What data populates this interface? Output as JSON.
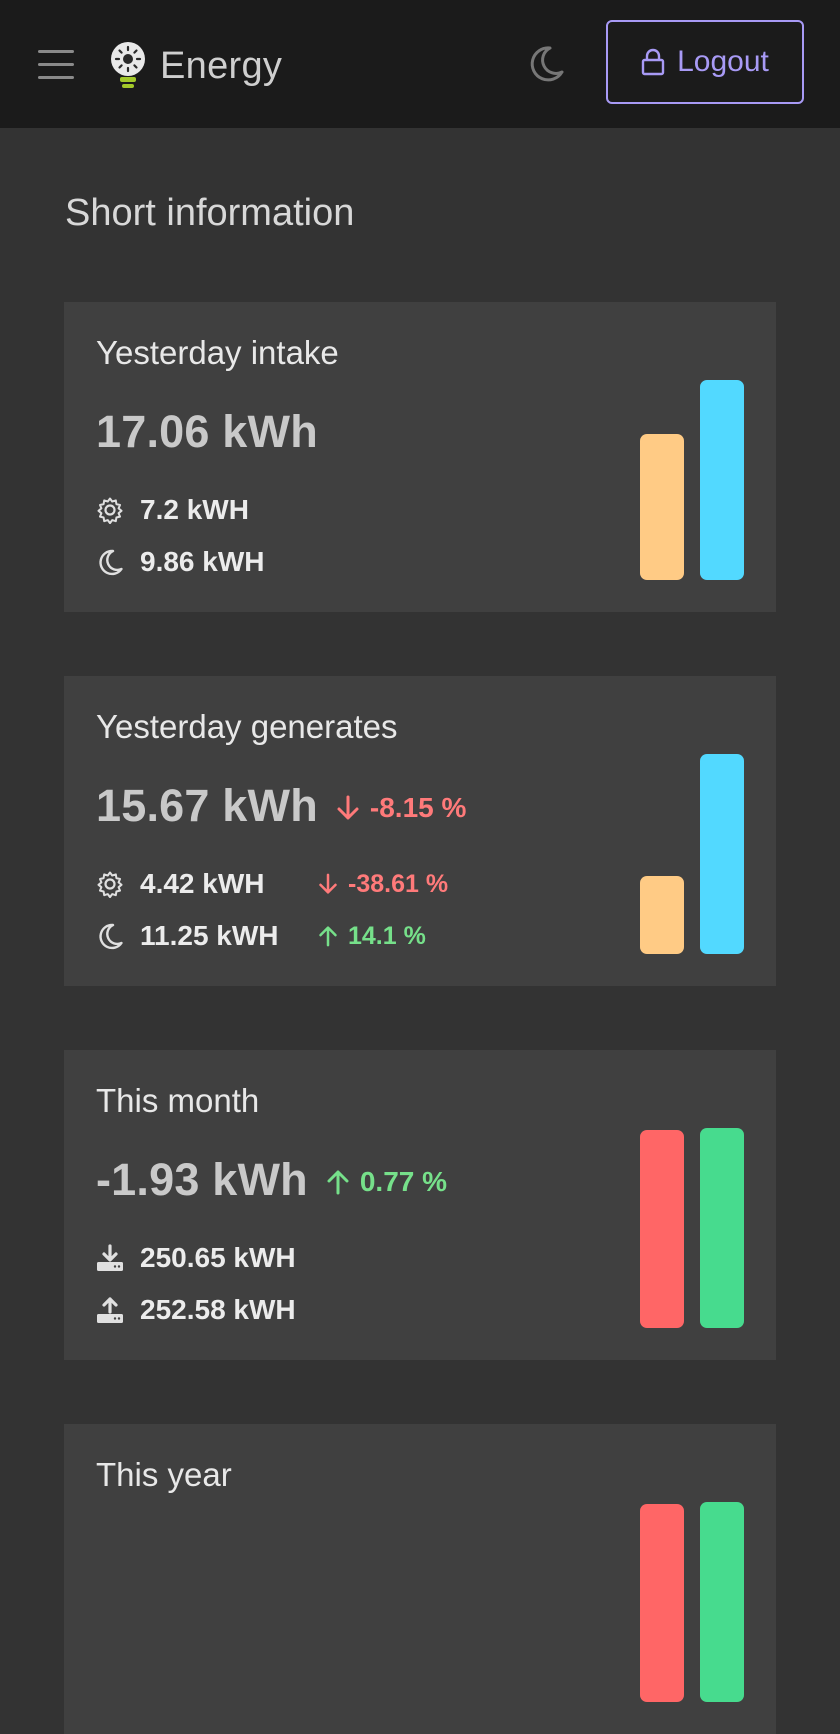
{
  "header": {
    "brand": "Energy",
    "logout_label": "Logout",
    "icons": {
      "menu": "hamburger-icon",
      "brand": "lightbulb-sun-icon",
      "theme": "moon-icon",
      "logout": "lock-icon"
    }
  },
  "section": {
    "title": "Short information"
  },
  "colors": {
    "navbar_bg": "#1b1b1b",
    "page_bg": "#333333",
    "card_bg": "#404040",
    "accent": "#a89af5",
    "bar_day": "#ffcb85",
    "bar_night": "#52d9ff",
    "bar_intake": "#ff6666",
    "bar_output": "#47db8e",
    "decrease": "#ff7a7a",
    "increase": "#76e08a"
  },
  "cards": [
    {
      "title": "Yesterday intake",
      "total": "17.06 kWh",
      "change": null,
      "rows": [
        {
          "icon": "gear-icon",
          "value": "7.2 kWH",
          "change": null
        },
        {
          "icon": "moon-icon",
          "value": "9.86 kWH",
          "change": null
        }
      ],
      "bars": [
        {
          "name": "day",
          "color": "#ffcb85",
          "level": 0.73
        },
        {
          "name": "night",
          "color": "#52d9ff",
          "level": 1.0
        }
      ]
    },
    {
      "title": "Yesterday generates",
      "total": "15.67 kWh",
      "change": {
        "direction": "down",
        "text": "-8.15 %"
      },
      "rows": [
        {
          "icon": "gear-icon",
          "value": "4.42 kWH",
          "change": {
            "direction": "down",
            "text": "-38.61 %"
          }
        },
        {
          "icon": "moon-icon",
          "value": "11.25 kWH",
          "change": {
            "direction": "up",
            "text": "14.1 %"
          }
        }
      ],
      "bars": [
        {
          "name": "day",
          "color": "#ffcb85",
          "level": 0.39
        },
        {
          "name": "night",
          "color": "#52d9ff",
          "level": 1.0
        }
      ]
    },
    {
      "title": "This month",
      "total": "-1.93 kWh",
      "change": {
        "direction": "up",
        "text": "0.77 %"
      },
      "rows": [
        {
          "icon": "download-icon",
          "value": "250.65 kWH",
          "change": null
        },
        {
          "icon": "upload-icon",
          "value": "252.58 kWH",
          "change": null
        }
      ],
      "bars": [
        {
          "name": "intake",
          "color": "#ff6666",
          "level": 0.99
        },
        {
          "name": "output",
          "color": "#47db8e",
          "level": 1.0
        }
      ]
    },
    {
      "title": "This year",
      "total": "",
      "change": null,
      "rows": [],
      "bars": [
        {
          "name": "intake",
          "color": "#ff6666",
          "level": 0.99
        },
        {
          "name": "output",
          "color": "#47db8e",
          "level": 1.0
        }
      ]
    }
  ]
}
